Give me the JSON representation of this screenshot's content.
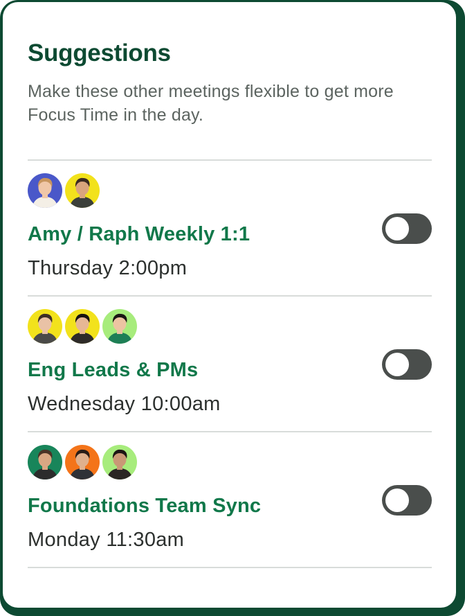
{
  "header": {
    "title": "Suggestions",
    "subtitle": "Make these other meetings flexible to get more Focus Time in the day."
  },
  "meetings": [
    {
      "name": "Amy / Raph Weekly 1:1",
      "time": "Thursday 2:00pm",
      "flexible": false,
      "avatars": [
        {
          "bg": "#4a58c9",
          "skin": "#f0c7a8",
          "hair": "#c8955e",
          "shirt": "#f4efe6"
        },
        {
          "bg": "#f2e21c",
          "skin": "#d9a47d",
          "hair": "#3a2a22",
          "shirt": "#3b3f3a"
        }
      ]
    },
    {
      "name": "Eng Leads & PMs",
      "time": "Wednesday 10:00am",
      "flexible": false,
      "avatars": [
        {
          "bg": "#f2e21c",
          "skin": "#e9c2a6",
          "hair": "#3d2e26",
          "shirt": "#4a4a48"
        },
        {
          "bg": "#f2e21c",
          "skin": "#e6b794",
          "hair": "#161311",
          "shirt": "#2e2b29"
        },
        {
          "bg": "#a7ec7c",
          "skin": "#ecc4a2",
          "hair": "#1a1614",
          "shirt": "#1e7f56"
        }
      ]
    },
    {
      "name": "Foundations Team Sync",
      "time": "Monday 11:30am",
      "flexible": false,
      "avatars": [
        {
          "bg": "#18855a",
          "skin": "#d9a783",
          "hair": "#4a3326",
          "shirt": "#2c2c2c"
        },
        {
          "bg": "#f47419",
          "skin": "#e0b08c",
          "hair": "#2a1d17",
          "shirt": "#2f3137"
        },
        {
          "bg": "#a7ec7c",
          "skin": "#c99876",
          "hair": "#1b1513",
          "shirt": "#2a2624"
        }
      ]
    }
  ],
  "colors": {
    "frame": "#0d4a32",
    "title": "#0d4a32",
    "meeting_name": "#11784a",
    "toggle_off": "#4a4e4c"
  }
}
